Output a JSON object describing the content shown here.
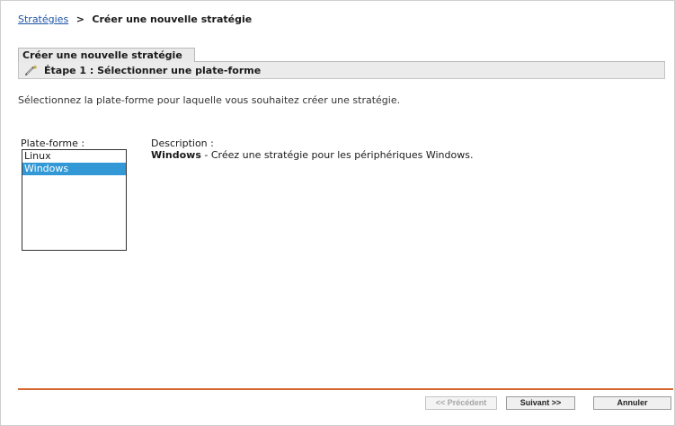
{
  "breadcrumb": {
    "link_label": "Stratégies",
    "separator": ">",
    "current_label": "Créer une nouvelle stratégie"
  },
  "tab": {
    "label": "Créer une nouvelle stratégie"
  },
  "step": {
    "icon": "wand-icon",
    "label": "Étape 1 : Sélectionner une plate-forme"
  },
  "intro_text": "Sélectionnez la plate-forme pour laquelle vous souhaitez créer une stratégie.",
  "platform": {
    "label": "Plate-forme :",
    "items": [
      {
        "label": "Linux",
        "selected": false
      },
      {
        "label": "Windows",
        "selected": true
      }
    ]
  },
  "description": {
    "label": "Description :",
    "name": "Windows",
    "text": " - Créez une stratégie pour les périphériques Windows."
  },
  "buttons": {
    "previous": "<< Précédent",
    "next": "Suivant >>",
    "cancel": "Annuler"
  },
  "colors": {
    "link": "#1d55a6",
    "selection": "#3399d6",
    "footer_rule": "#d5672e"
  }
}
